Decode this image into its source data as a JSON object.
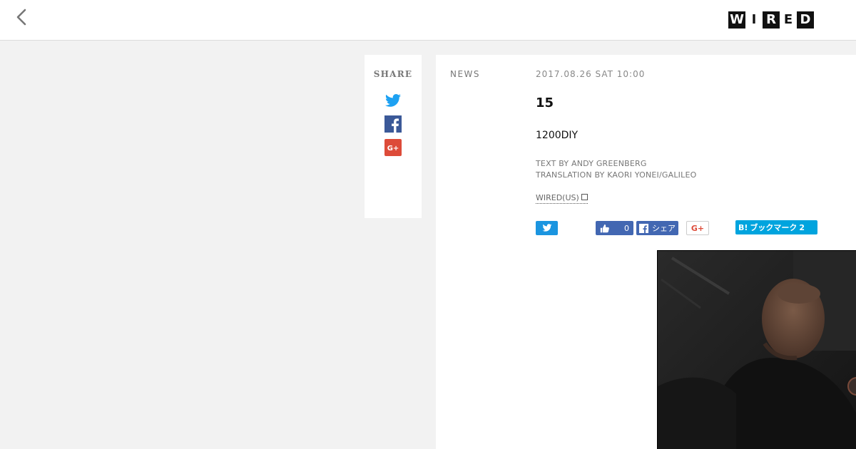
{
  "header": {
    "back_icon": "chevron-left-icon",
    "logo_letters": [
      "W",
      "I",
      "R",
      "E",
      "D"
    ]
  },
  "share": {
    "title": "SHARE",
    "icons": [
      "twitter-icon",
      "facebook-icon",
      "google-plus-icon"
    ],
    "colors": {
      "twitter": "#1da1f2",
      "facebook": "#3b5998",
      "google_plus": "#dd4b39"
    }
  },
  "article": {
    "category": "NEWS",
    "date": "2017.08.26 SAT 10:00",
    "title": "15",
    "lead": "1200DIY",
    "text_by": "TEXT BY ANDY GREENBERG",
    "translation_by": "TRANSLATION BY KAORI YONEI/GALILEO",
    "source_link": "WIRED(US)"
  },
  "social_buttons": {
    "like_count": "0",
    "fb_share_label": "シェア",
    "gplus_label": "G+",
    "hatena_label": "ブックマーク",
    "hatena_prefix": "B!",
    "hatena_count": "2"
  }
}
